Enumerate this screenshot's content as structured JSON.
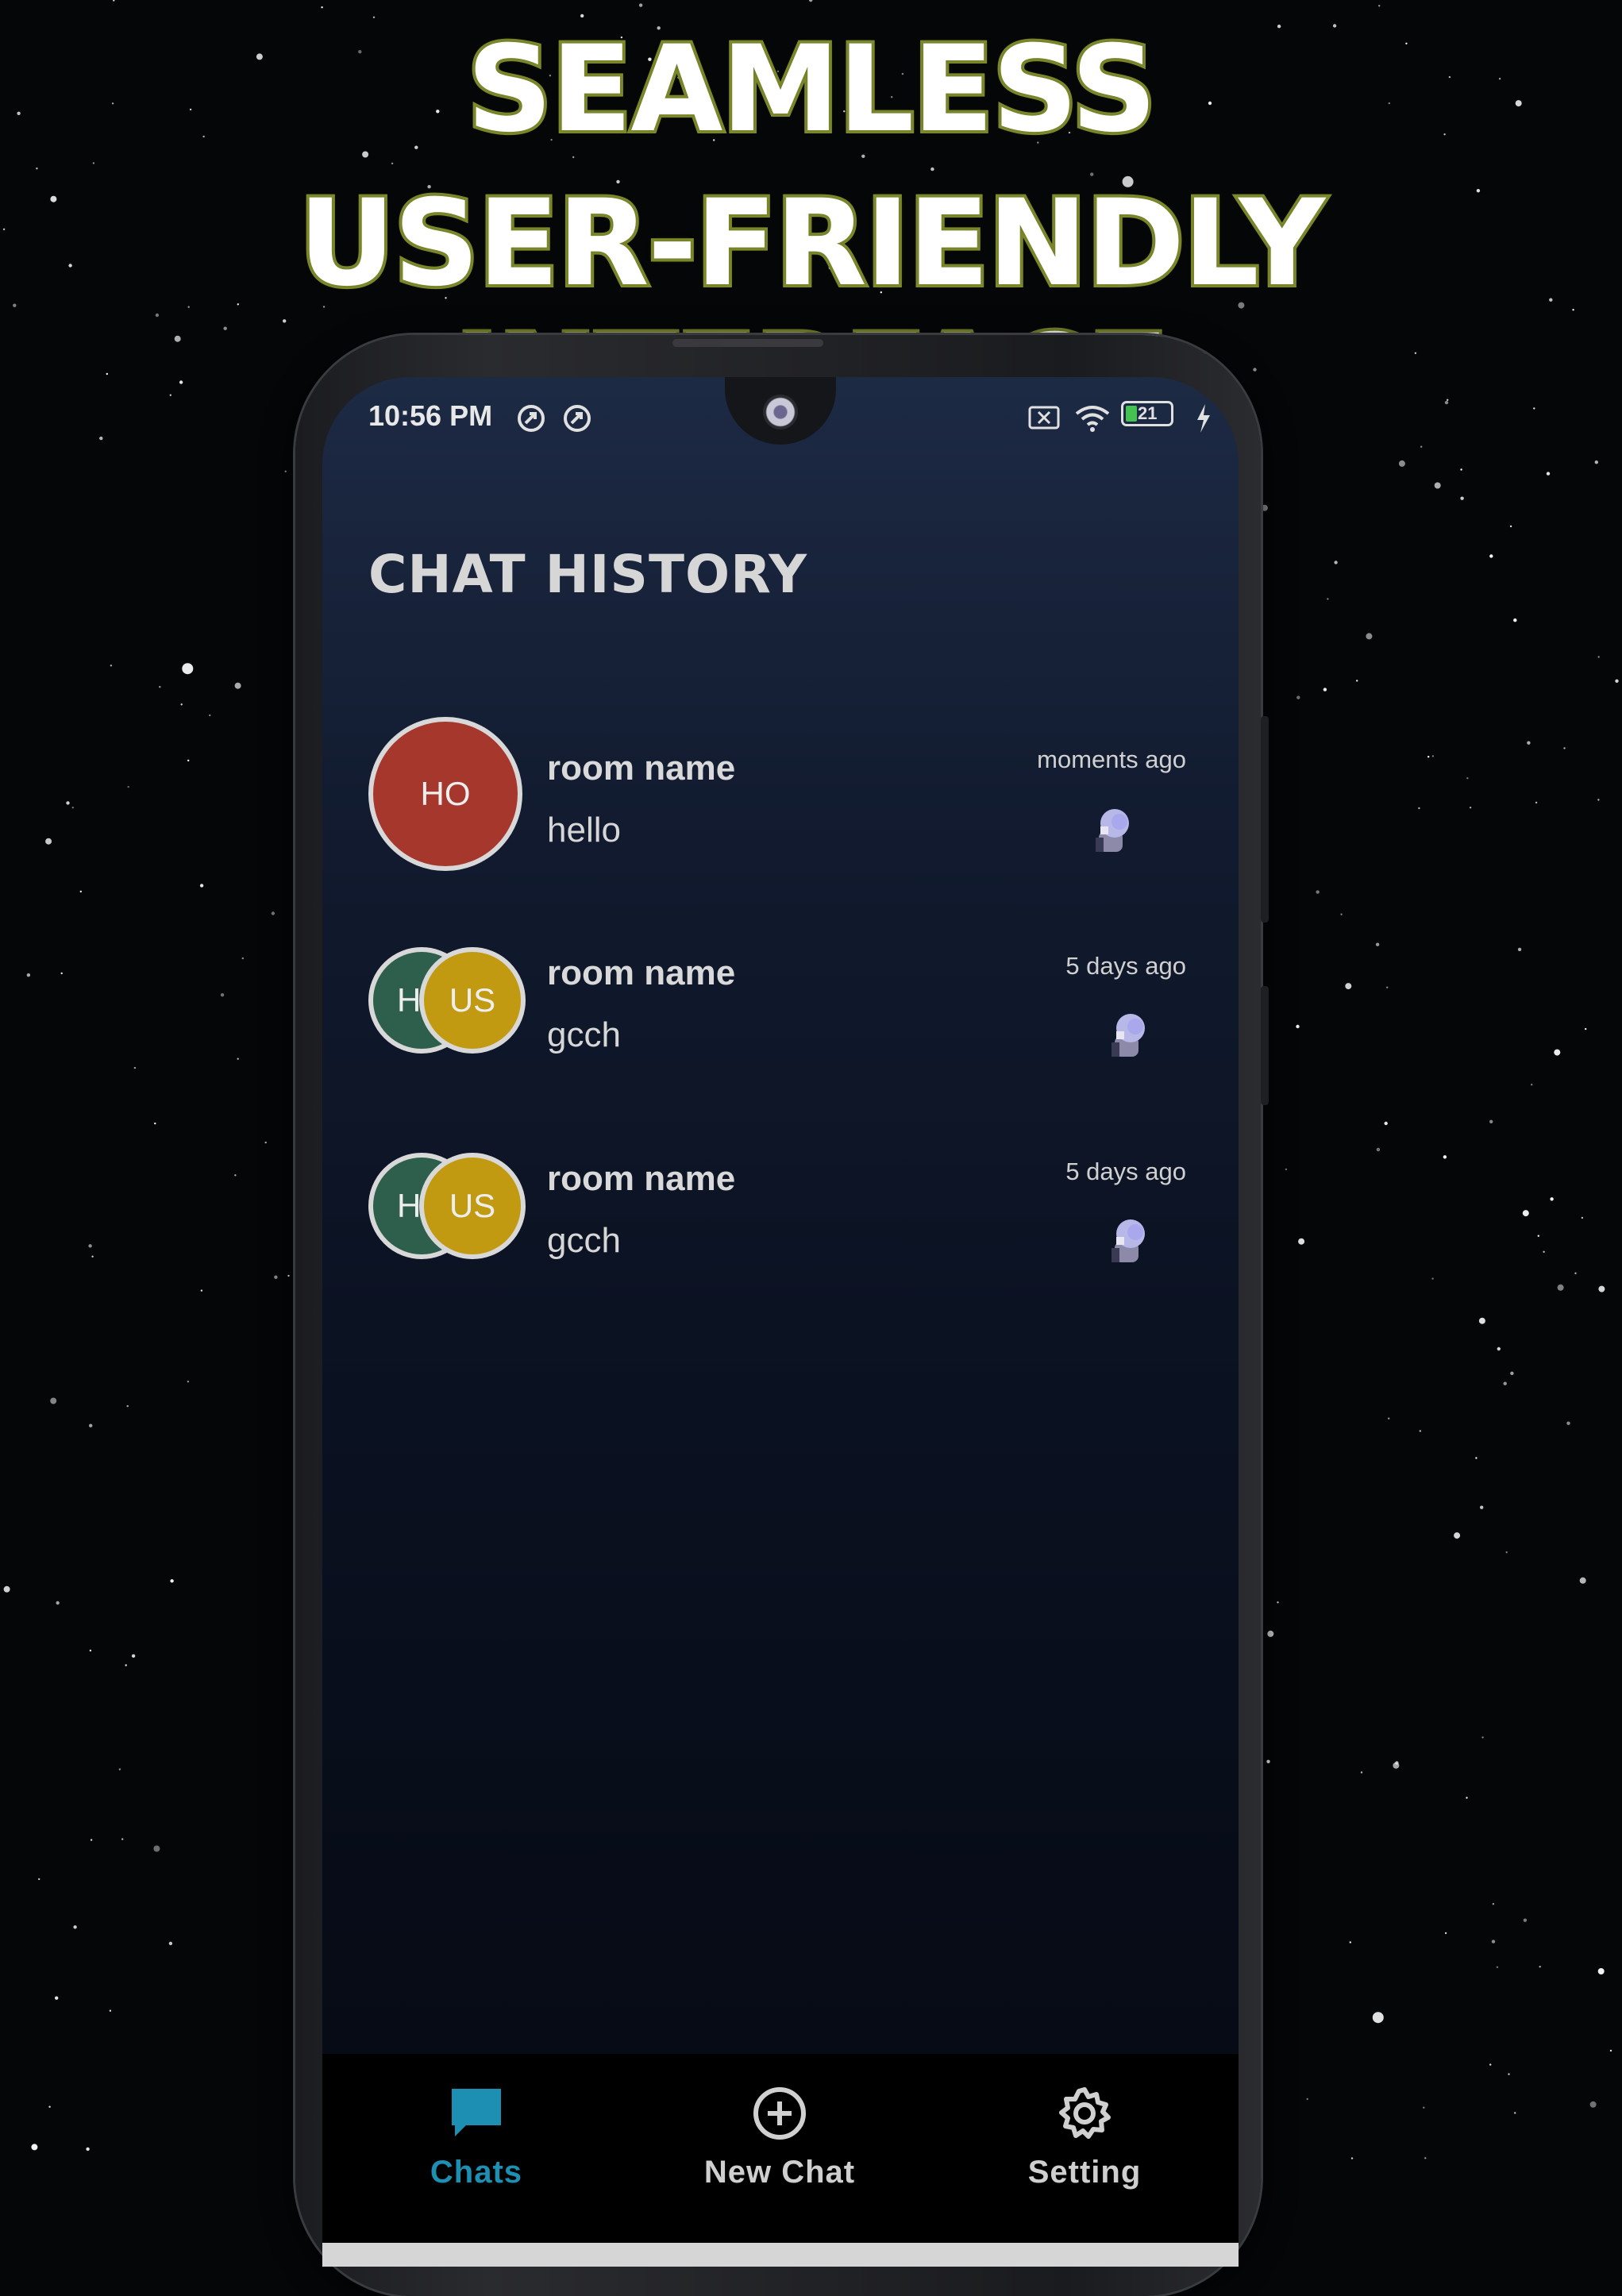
{
  "headline": {
    "line1": "SEAMLESS",
    "line2": "USER-FRIENDLY INTERFACE"
  },
  "status_bar": {
    "time": "10:56 PM",
    "battery": "21"
  },
  "screen": {
    "title": "CHAT HISTORY"
  },
  "chats": [
    {
      "room_name": "room name",
      "last_message": "hello",
      "time_ago": "moments ago",
      "avatars": [
        "HO"
      ]
    },
    {
      "room_name": "room name",
      "last_message": "gcch",
      "time_ago": "5 days ago",
      "avatars": [
        "H",
        "US"
      ]
    },
    {
      "room_name": "room name",
      "last_message": "gcch",
      "time_ago": "5 days ago",
      "avatars": [
        "H",
        "US"
      ]
    }
  ],
  "nav": {
    "chats": "Chats",
    "new_chat": "New Chat",
    "setting": "Setting"
  },
  "colors": {
    "headline_outline": "#7e8a2c",
    "accent": "#1c8fb3",
    "avatar_red": "#a6372c",
    "avatar_green": "#2e5e4c",
    "avatar_gold": "#c29a12"
  }
}
